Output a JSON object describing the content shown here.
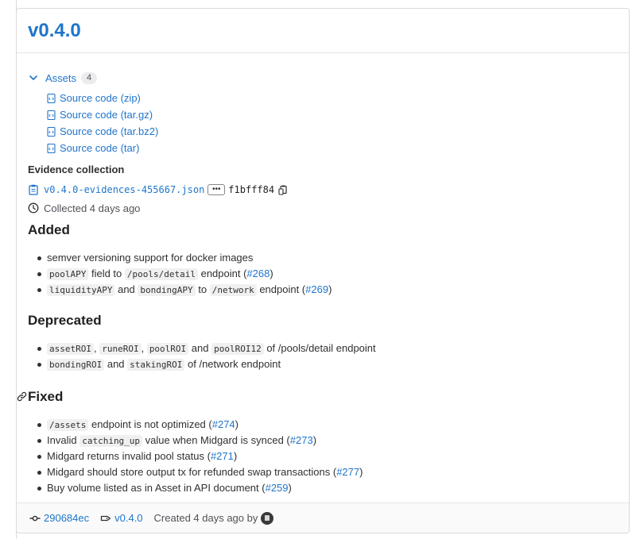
{
  "release": {
    "title": "v0.4.0"
  },
  "assets": {
    "label": "Assets",
    "count": "4",
    "items": [
      {
        "label": "Source code (zip)"
      },
      {
        "label": "Source code (tar.gz)"
      },
      {
        "label": "Source code (tar.bz2)"
      },
      {
        "label": "Source code (tar)"
      }
    ]
  },
  "evidence": {
    "title": "Evidence collection",
    "file": "v0.4.0-evidences-455667.json",
    "sha": "f1bfff84",
    "collected": "Collected 4 days ago"
  },
  "sections": {
    "added": {
      "title": "Added",
      "item1": "semver versioning support for docker images",
      "item2": {
        "code1": "poolAPY",
        "t1": " field to ",
        "code2": "/pools/detail",
        "t2": " endpoint (",
        "link": "#268",
        "t3": ")"
      },
      "item3": {
        "code1": "liquidityAPY",
        "t1": " and ",
        "code2": "bondingAPY",
        "t2": " to ",
        "code3": "/network",
        "t3": " endpoint (",
        "link": "#269",
        "t4": ")"
      }
    },
    "deprecated": {
      "title": "Deprecated",
      "item1": {
        "code1": "assetROI",
        "s1": ", ",
        "code2": "runeROI",
        "s2": ", ",
        "code3": "poolROI",
        "t1": " and ",
        "code4": "poolROI12",
        "t2": " of /pools/detail endpoint"
      },
      "item2": {
        "code1": "bondingROI",
        "t1": " and ",
        "code2": "stakingROI",
        "t2": " of /network endpoint"
      }
    },
    "fixed": {
      "title": "Fixed",
      "item1": {
        "code1": "/assets",
        "t1": " endpoint is not optimized (",
        "link": "#274",
        "t2": ")"
      },
      "item2": {
        "t0": "Invalid ",
        "code1": "catching_up",
        "t1": " value when Midgard is synced (",
        "link": "#273",
        "t2": ")"
      },
      "item3": {
        "t0": "Midgard returns invalid pool status (",
        "link": "#271",
        "t1": ")"
      },
      "item4": {
        "t0": "Midgard should store output tx for refunded swap transactions (",
        "link": "#277",
        "t1": ")"
      },
      "item5": {
        "t0": "Buy volume listed as in Asset in API document (",
        "link": "#259",
        "t1": ")"
      }
    }
  },
  "footer": {
    "commit": "290684ec",
    "tag": "v0.4.0",
    "created": "Created 4 days ago by"
  },
  "colors": {
    "link": "#1f75cb",
    "text": "#303030",
    "border": "#dbdbdb"
  }
}
